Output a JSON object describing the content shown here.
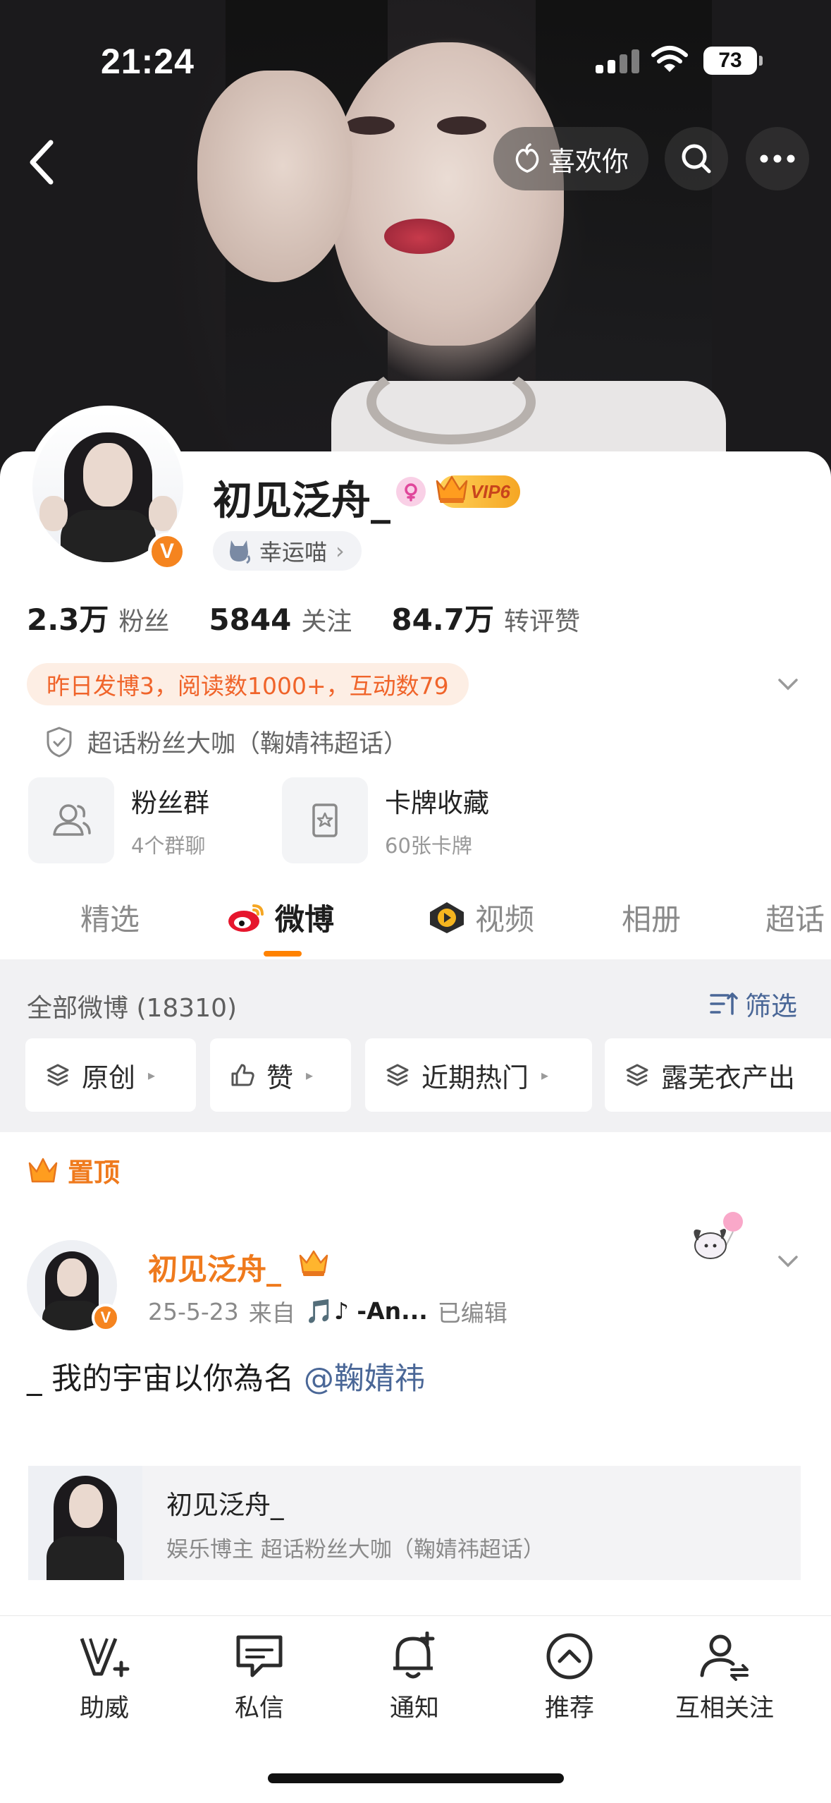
{
  "status_bar": {
    "time": "21:24",
    "battery": "73"
  },
  "header": {
    "like_label": "喜欢你"
  },
  "profile": {
    "name": "初见泛舟_",
    "vip_label": "VIP6",
    "lucky_label": "幸运喵",
    "verified_mark": "V",
    "stats": [
      {
        "value": "2.3万",
        "label": "粉丝"
      },
      {
        "value": "5844",
        "label": "关注"
      },
      {
        "value": "84.7万",
        "label": "转评赞"
      }
    ],
    "daily_summary": "昨日发博3，阅读数1000+，互动数79",
    "superfan": "超话粉丝大咖（鞠婧祎超话）",
    "tiles": [
      {
        "title": "粉丝群",
        "subtitle": "4个群聊"
      },
      {
        "title": "卡牌收藏",
        "subtitle": "60张卡牌"
      }
    ]
  },
  "tabs": [
    "精选",
    "微博",
    "视频",
    "相册",
    "超话"
  ],
  "active_tab": "微博",
  "filter": {
    "all_label": "全部微博 (18310)",
    "screen_label": "筛选",
    "chips": [
      "原创",
      "赞",
      "近期热门",
      "露芜衣产出"
    ]
  },
  "post": {
    "pinned_label": "置顶",
    "author": "初见泛舟_",
    "date": "25-5-23",
    "from_label": "来自",
    "source": "🎵♪ -An...",
    "edited": "已编辑",
    "text_prefix": "_ 我的宇宙以你為名 ",
    "mention": "@鞠婧祎",
    "card_title": "初见泛舟_",
    "card_subtitle": "娱乐博主 超话粉丝大咖（鞠婧祎超话）"
  },
  "bottom_bar": [
    {
      "label": "助威",
      "icon": "cheer-v-icon"
    },
    {
      "label": "私信",
      "icon": "chat-icon"
    },
    {
      "label": "通知",
      "icon": "bell-plus-icon"
    },
    {
      "label": "推荐",
      "icon": "chevron-up-circle-icon"
    },
    {
      "label": "互相关注",
      "icon": "mutual-follow-icon"
    }
  ],
  "colors": {
    "accent": "#ff8200",
    "link": "#4a6797",
    "orange_text": "#ef7a1d"
  }
}
